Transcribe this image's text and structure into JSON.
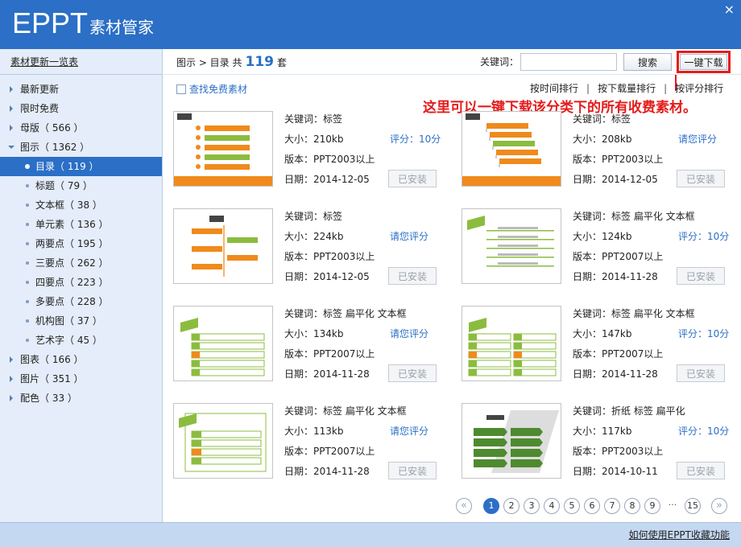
{
  "app": {
    "logo_main": "EPPT",
    "logo_sub": "素材管家",
    "close_icon": "×"
  },
  "sidebar": {
    "top_link": "素材更新一览表",
    "items": [
      {
        "label": "最新更新",
        "level": 1
      },
      {
        "label": "限时免费",
        "level": 1
      },
      {
        "label": "母版（ 566 ）",
        "level": 1
      },
      {
        "label": "图示（ 1362 ）",
        "level": 1,
        "open": true
      },
      {
        "label": "目录（ 119 ）",
        "level": 2,
        "active": true
      },
      {
        "label": "标题（ 79 ）",
        "level": 2
      },
      {
        "label": "文本框（ 38 ）",
        "level": 2
      },
      {
        "label": "单元素（ 136 ）",
        "level": 2
      },
      {
        "label": "两要点（ 195 ）",
        "level": 2
      },
      {
        "label": "三要点（ 262 ）",
        "level": 2
      },
      {
        "label": "四要点（ 223 ）",
        "level": 2
      },
      {
        "label": "多要点（ 228 ）",
        "level": 2
      },
      {
        "label": "机构图（ 37 ）",
        "level": 2
      },
      {
        "label": "艺术字（ 45 ）",
        "level": 2
      },
      {
        "label": "图表（ 166 ）",
        "level": 1
      },
      {
        "label": "图片（ 351 ）",
        "level": 1
      },
      {
        "label": "配色（ 33 ）",
        "level": 1
      }
    ]
  },
  "header": {
    "breadcrumb_prefix": "图示 > 目录 共",
    "count": "119",
    "breadcrumb_suffix": "套",
    "keyword_label": "关键词：",
    "keyword_value": "",
    "search_label": "搜索",
    "download_all_label": "一键下载"
  },
  "filters": {
    "free_label": "查找免费素材",
    "sort_time": "按时间排行",
    "sort_downloads": "按下载量排行",
    "sort_rating": "按评分排行",
    "separator": "|"
  },
  "annotation": "这里可以一键下载该分类下的所有收费素材。",
  "items": [
    {
      "keywords": "关键词：标签",
      "size": "大小：210kb",
      "rating": "评分：10分",
      "version": "版本：PPT2003以上",
      "date": "日期：2014-12-05",
      "status": "已安装",
      "thumb": "toc-orange-vertical"
    },
    {
      "keywords": "关键词：标签",
      "size": "大小：208kb",
      "rating": "请您评分",
      "version": "版本：PPT2003以上",
      "date": "日期：2014-12-05",
      "status": "已安装",
      "thumb": "toc-orange-steps"
    },
    {
      "keywords": "关键词：标签",
      "size": "大小：224kb",
      "rating": "请您评分",
      "version": "版本：PPT2003以上",
      "date": "日期：2014-12-05",
      "status": "已安装",
      "thumb": "toc-orange-tree"
    },
    {
      "keywords": "关键词：标签 扁平化 文本框",
      "size": "大小：124kb",
      "rating": "评分：10分",
      "version": "版本：PPT2007以上",
      "date": "日期：2014-11-28",
      "status": "已安装",
      "thumb": "toc-green-lines"
    },
    {
      "keywords": "关键词：标签 扁平化 文本框",
      "size": "大小：134kb",
      "rating": "请您评分",
      "version": "版本：PPT2007以上",
      "date": "日期：2014-11-28",
      "status": "已安装",
      "thumb": "toc-green-numbered"
    },
    {
      "keywords": "关键词：标签 扁平化 文本框",
      "size": "大小：147kb",
      "rating": "评分：10分",
      "version": "版本：PPT2007以上",
      "date": "日期：2014-11-28",
      "status": "已安装",
      "thumb": "toc-green-grid"
    },
    {
      "keywords": "关键词：标签 扁平化 文本框",
      "size": "大小：113kb",
      "rating": "请您评分",
      "version": "版本：PPT2007以上",
      "date": "日期：2014-11-28",
      "status": "已安装",
      "thumb": "toc-green-frame"
    },
    {
      "keywords": "关键词：折纸 标签 扁平化",
      "size": "大小：117kb",
      "rating": "评分：10分",
      "version": "版本：PPT2003以上",
      "date": "日期：2014-10-11",
      "status": "已安装",
      "thumb": "toc-green-origami"
    }
  ],
  "pagination": {
    "prev_icon": "«",
    "pages": [
      "1",
      "2",
      "3",
      "4",
      "5",
      "6",
      "7",
      "8",
      "9"
    ],
    "current": "1",
    "ellipsis": "···",
    "last": "15",
    "next_icon": "»"
  },
  "footer": {
    "help_link": "如何使用EPPT收藏功能"
  },
  "colors": {
    "brand": "#2b6fc6",
    "highlight": "#e41c1c",
    "sidebar_bg": "#e4edf9",
    "footer_bg": "#c5d8f1"
  }
}
